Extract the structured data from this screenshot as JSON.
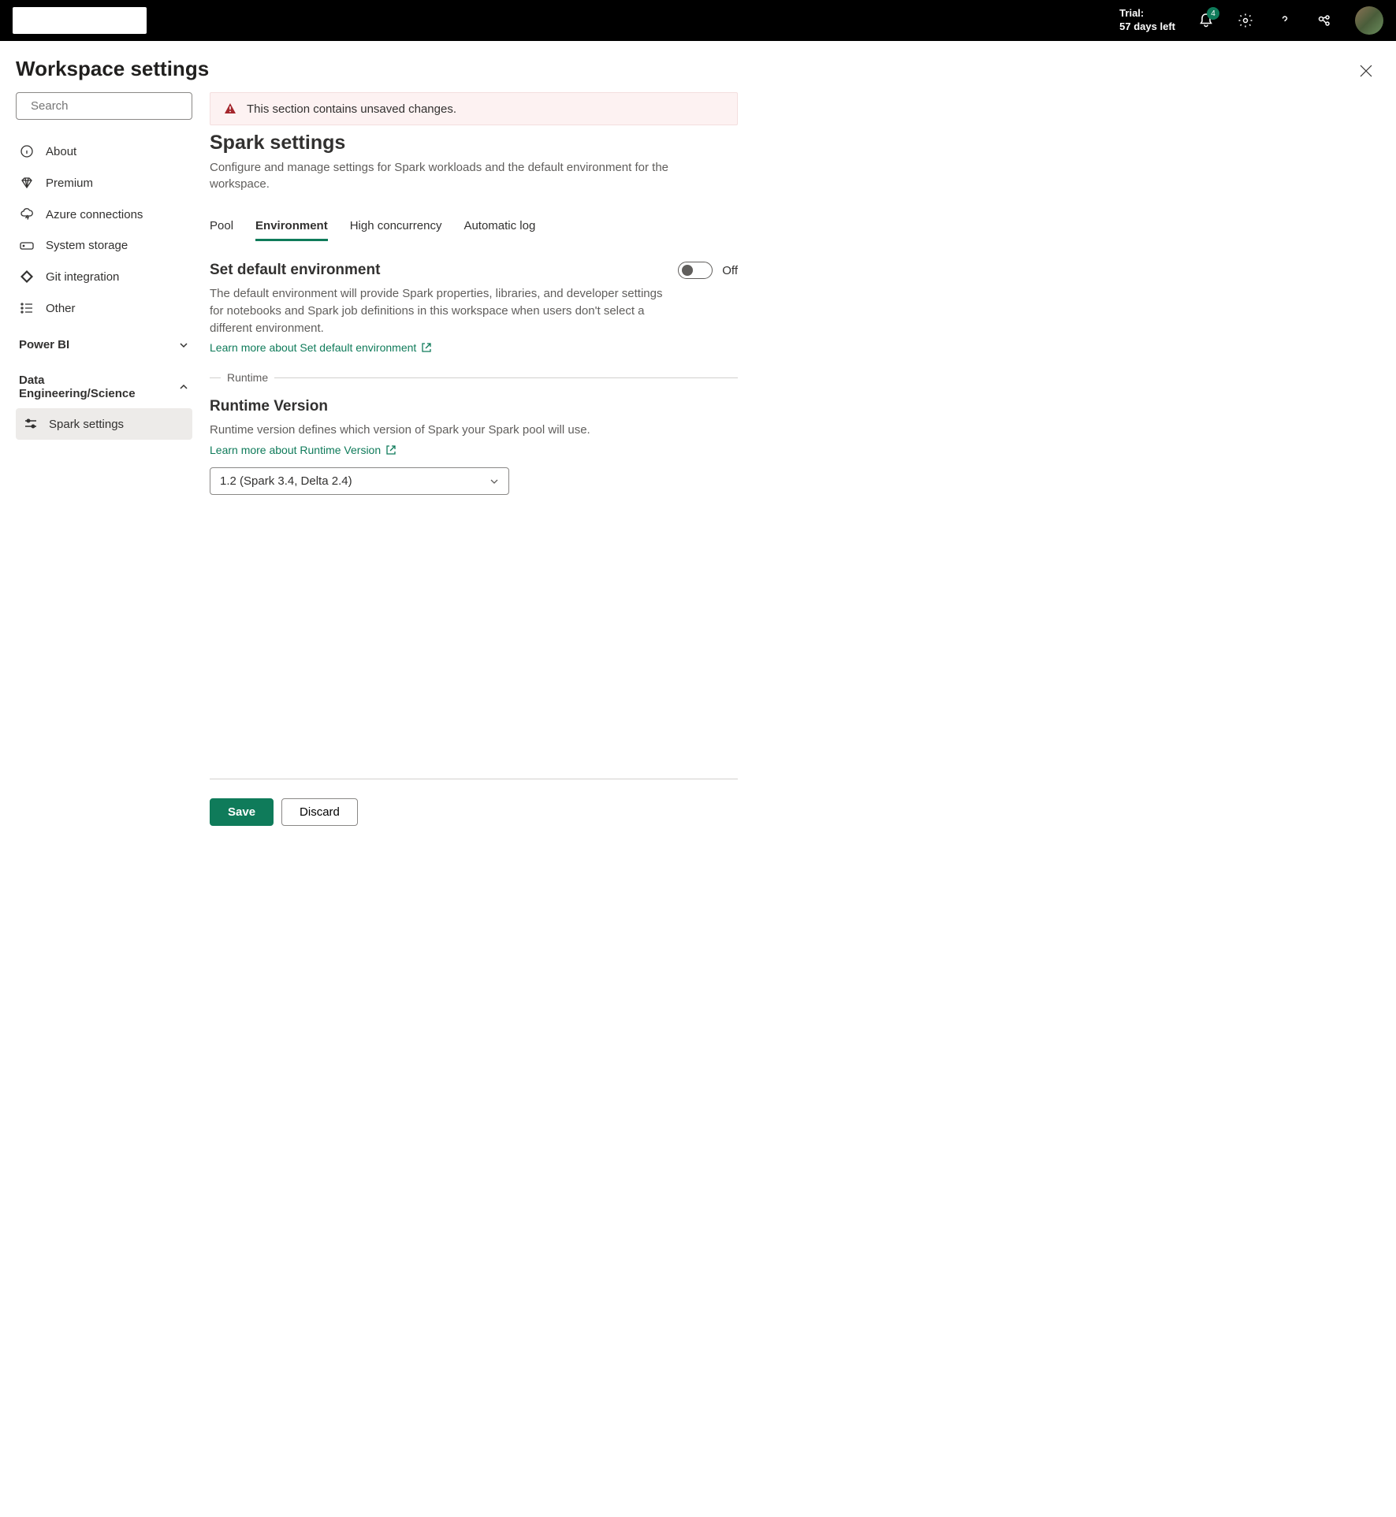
{
  "topbar": {
    "trial_label": "Trial:",
    "trial_days": "57 days left",
    "notification_count": "4"
  },
  "page": {
    "title": "Workspace settings"
  },
  "sidebar": {
    "search_placeholder": "Search",
    "items": [
      {
        "label": "About"
      },
      {
        "label": "Premium"
      },
      {
        "label": "Azure connections"
      },
      {
        "label": "System storage"
      },
      {
        "label": "Git integration"
      },
      {
        "label": "Other"
      }
    ],
    "groups": {
      "powerbi": "Power BI",
      "datasci": "Data Engineering/Science"
    },
    "sub": {
      "spark": "Spark settings"
    }
  },
  "alert": {
    "text": "This section contains unsaved changes."
  },
  "spark": {
    "title": "Spark settings",
    "desc": "Configure and manage settings for Spark workloads and the default environment for the workspace.",
    "tabs": {
      "pool": "Pool",
      "env": "Environment",
      "hc": "High concurrency",
      "alog": "Automatic log"
    },
    "defenv": {
      "title": "Set default environment",
      "toggle_state": "Off",
      "desc": "The default environment will provide Spark properties, libraries, and developer settings for notebooks and Spark job definitions in this workspace when users don't select a different environment.",
      "learn": "Learn more about Set default environment"
    },
    "runtime_fieldset": "Runtime",
    "runtime": {
      "title": "Runtime Version",
      "desc": "Runtime version defines which version of Spark your Spark pool will use.",
      "learn": "Learn more about Runtime Version",
      "selected": "1.2 (Spark 3.4, Delta 2.4)"
    }
  },
  "footer": {
    "save": "Save",
    "discard": "Discard"
  }
}
